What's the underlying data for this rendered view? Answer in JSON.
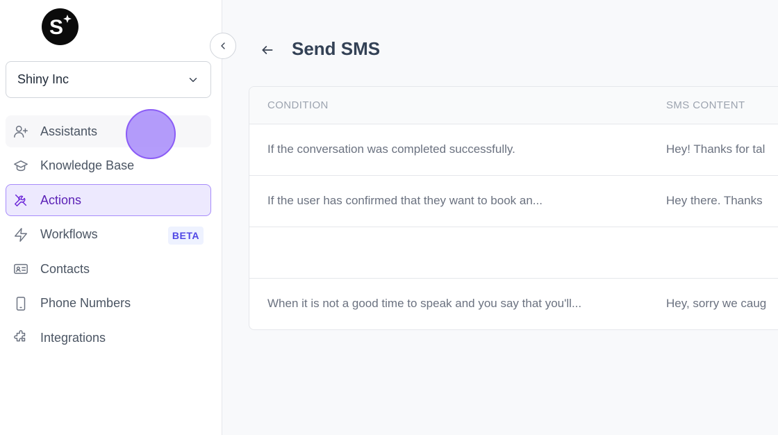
{
  "app": {
    "logo_letter": "S"
  },
  "sidebar": {
    "org_name": "Shiny Inc",
    "items": [
      {
        "label": "Assistants",
        "icon": "user-plus-icon",
        "state": "hover"
      },
      {
        "label": "Knowledge Base",
        "icon": "graduation-cap-icon",
        "state": ""
      },
      {
        "label": "Actions",
        "icon": "tools-icon",
        "state": "active"
      },
      {
        "label": "Workflows",
        "icon": "lightning-icon",
        "state": "",
        "badge": "BETA"
      },
      {
        "label": "Contacts",
        "icon": "contact-card-icon",
        "state": ""
      },
      {
        "label": "Phone Numbers",
        "icon": "phone-icon",
        "state": ""
      },
      {
        "label": "Integrations",
        "icon": "puzzle-icon",
        "state": ""
      }
    ]
  },
  "page": {
    "title": "Send SMS"
  },
  "table": {
    "headers": [
      "CONDITION",
      "SMS CONTENT"
    ],
    "rows": [
      {
        "condition": "If the conversation was completed successfully.",
        "content": "Hey! Thanks for tal"
      },
      {
        "condition": "If the user has confirmed that they want to book an...",
        "content": "Hey there. Thanks"
      },
      {
        "condition": "",
        "content": ""
      },
      {
        "condition": "When it is not a good time to speak and you say that you'll...",
        "content": "Hey, sorry we caug"
      }
    ]
  },
  "colors": {
    "accent": "#8b5cf6",
    "active_bg": "#ede9fe"
  }
}
